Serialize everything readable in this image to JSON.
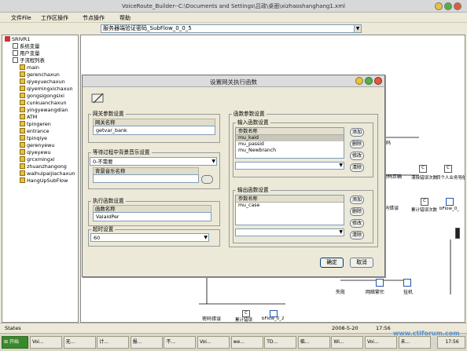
{
  "window": {
    "title": "VoiceRoute_Builder--C:\\Documents and Settings\\吕政\\桌面\\xizhaoshanghang1.xml"
  },
  "menu": [
    "文件File",
    "工作区操作",
    "节点操作",
    "帮助"
  ],
  "flow_combo": {
    "value": "服务器端验证密码_SubFlow_0_0_5"
  },
  "tree": {
    "root": "SRIVR1",
    "system_vars": "系统变量",
    "user_vars": "用户变量",
    "subflow_list": "子流程列表",
    "items": [
      "main",
      "gerenchaxun",
      "qiyeyuechaxun",
      "qiyemingxichaxun",
      "gongsigongsixi",
      "cunkuanchaxun",
      "yingyewangdian",
      "ATM",
      "tpingeren",
      "entrance",
      "tpinqiye",
      "gerenyewu",
      "qiyeyewu",
      "grcxmingxi",
      "zhuanzhangong",
      "waihuipaijiachaxun",
      "HangUpSubFlow"
    ]
  },
  "canvas": {
    "labels": [
      "码",
      "密码正确",
      "清除错误次数",
      "转个人业务导航",
      "码错误",
      "累计错误次数",
      "bFlow_0_",
      "失败",
      "网络繁忙",
      "挂机",
      "密码错误",
      "累计错误",
      "bFlow_0_2"
    ]
  },
  "dialog": {
    "title": "设置网关执行函数",
    "gateway_group": "网关参数设置",
    "gateway_name_label": "网关名称",
    "gateway_name_value": "getvar_bank",
    "wait_group": "等待过程中背景音乐设置",
    "wait_combo_value": "0-不需要",
    "bg_music_label": "背景音乐名称",
    "exec_group": "执行函数设置",
    "func_name_label": "函数名称",
    "func_name_value": "ValaidPer",
    "timeout_group": "超时设置",
    "timeout_value": "60",
    "func_params_group": "函数参数设置",
    "input_group": "输入函数设置",
    "param_header": "参数名称",
    "inputs": [
      "mu_kaid",
      "mu_passid",
      "mu_Newbranch"
    ],
    "output_group": "输出函数设置",
    "outputs": [
      "mu_case"
    ],
    "btn_add": "添加",
    "btn_delete": "删除",
    "btn_edit": "修改",
    "btn_clear": "清除",
    "ok": "确定",
    "cancel": "取消"
  },
  "status": {
    "text": "States",
    "time": "17:56",
    "date": "2008-5-20"
  },
  "taskbar": {
    "start": "开始",
    "items": [
      "Voi...",
      "无...",
      "计...",
      "报...",
      "不...",
      "Voi...",
      "we...",
      "TD...",
      "临...",
      "Wi...",
      "Voi...",
      "未..."
    ],
    "clock": "17:56"
  },
  "watermark": "www.ctiforum.com"
}
